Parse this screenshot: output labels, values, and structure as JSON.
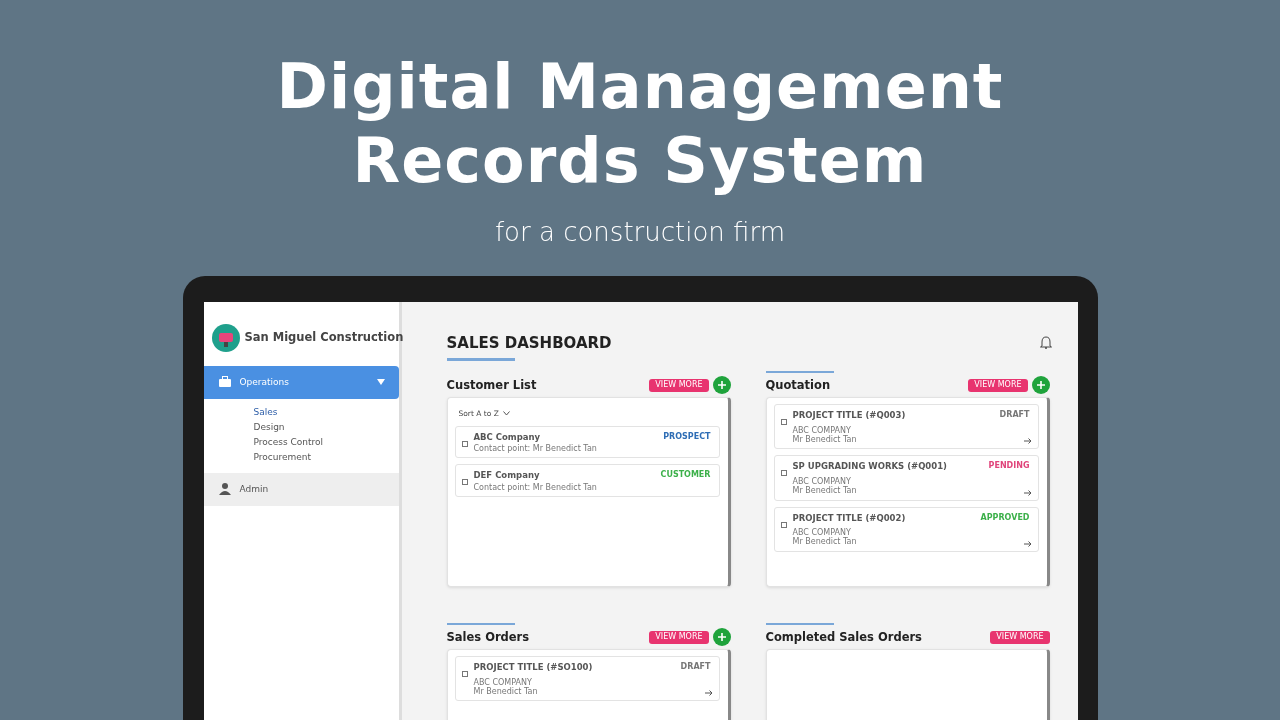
{
  "headline": [
    "Digital Management",
    "Records System"
  ],
  "subtitle": "for a construction firm",
  "app": {
    "brand": "San Miguel Construction",
    "sidebar": [
      {
        "label": "Operations",
        "selected": true,
        "expanded": true,
        "children": [
          {
            "label": "Sales",
            "selected": true
          },
          {
            "label": "Design",
            "selected": false
          },
          {
            "label": "Process Control",
            "selected": false
          },
          {
            "label": "Procurement",
            "selected": false
          }
        ]
      },
      {
        "label": "Admin",
        "selected": false
      }
    ],
    "page_title": "SALES DASHBOARD",
    "panels": [
      {
        "title": "Customer List",
        "accent": false,
        "view_more": "VIEW MORE",
        "add": true,
        "sort": "Sort A to Z",
        "rows": [
          {
            "kind": "customer",
            "checked": false,
            "title": "ABC Company",
            "lines": [
              "Contact point: Mr Benedict Tan"
            ],
            "status": "PROSPECT",
            "color": "#2e6db5"
          },
          {
            "kind": "customer",
            "checked": false,
            "title": "DEF Company",
            "lines": [
              "Contact point: Mr Benedict Tan"
            ],
            "status": "CUSTOMER",
            "color": "#3cb04a"
          }
        ]
      },
      {
        "title": "Quotation",
        "accent": true,
        "view_more": "VIEW MORE",
        "add": true,
        "rows": [
          {
            "kind": "project",
            "checked": false,
            "title": "PROJECT TITLE (#Q003)",
            "lines": [
              "ABC COMPANY",
              "Mr Benedict Tan"
            ],
            "status": "DRAFT",
            "color": "#777777"
          },
          {
            "kind": "project",
            "checked": false,
            "title": "SP UPGRADING WORKS (#Q001)",
            "lines": [
              "ABC COMPANY",
              "Mr Benedict Tan"
            ],
            "status": "PENDING",
            "color": "#e0457b"
          },
          {
            "kind": "project",
            "checked": false,
            "title": "PROJECT TITLE (#Q002)",
            "lines": [
              "ABC COMPANY",
              "Mr Benedict Tan"
            ],
            "status": "APPROVED",
            "color": "#3cb04a"
          }
        ]
      },
      {
        "title": "Sales Orders",
        "accent": true,
        "view_more": "VIEW MORE",
        "add": true,
        "rows": [
          {
            "kind": "project",
            "checked": false,
            "title": "PROJECT TITLE (#SO100)",
            "lines": [
              "ABC COMPANY",
              "Mr Benedict Tan"
            ],
            "status": "DRAFT",
            "color": "#777777"
          }
        ]
      },
      {
        "title": "Completed Sales Orders",
        "accent": true,
        "view_more": "VIEW MORE",
        "add": false
      }
    ]
  }
}
